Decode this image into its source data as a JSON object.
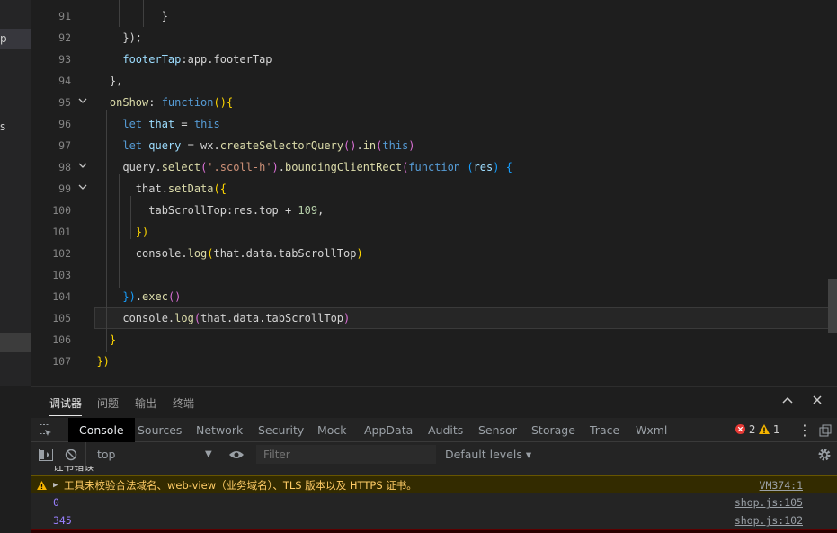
{
  "explorer": {
    "items": [
      {
        "label": "p"
      },
      {
        "label": "s"
      }
    ]
  },
  "editor": {
    "lines": [
      {
        "n": "91",
        "html": "<span class='plain'>            }</span>"
      },
      {
        "n": "92",
        "html": "<span class='plain'>      });</span>"
      },
      {
        "n": "93",
        "html": "<span class='prop'>      footerTap</span><span class='plain'>:app.footerTap</span>"
      },
      {
        "n": "94",
        "html": "<span class='plain'>    },</span>"
      },
      {
        "n": "95",
        "html": "<span class='fn'>    onShow</span><span class='plain'>: </span><span class='kw'>function</span><span class='yel'>(){</span>"
      },
      {
        "n": "96",
        "html": "<span class='kw'>      let </span><span class='var'>that</span><span class='plain'> = </span><span class='kw'>this</span>"
      },
      {
        "n": "97",
        "html": "<span class='kw'>      let </span><span class='var'>query</span><span class='plain'> = wx.</span><span class='fn'>createSelectorQuery</span><span class='pur'>()</span><span class='plain'>.</span><span class='fn'>in</span><span class='pur'>(</span><span class='kw'>this</span><span class='pur'>)</span>"
      },
      {
        "n": "98",
        "html": "<span class='plain'>      query.</span><span class='fn'>select</span><span class='pur'>(</span><span class='str'>'.scoll-h'</span><span class='pur'>)</span><span class='plain'>.</span><span class='fn'>boundingClientRect</span><span class='pur'>(</span><span class='kw'>function</span><span class='plain'> </span><span class='blu'>(</span><span class='prop'>res</span><span class='blu'>)</span><span class='plain'> </span><span class='blu'>{</span>"
      },
      {
        "n": "99",
        "html": "<span class='plain'>        that.</span><span class='fn'>setData</span><span class='yel'>({</span>"
      },
      {
        "n": "100",
        "html": "<span class='plain'>          tabScrollTop:res.top + </span><span class='num'>109</span><span class='plain'>,</span>"
      },
      {
        "n": "101",
        "html": "<span class='yel'>        })</span>"
      },
      {
        "n": "102",
        "html": "<span class='plain'>        console.</span><span class='fn'>log</span><span class='yel'>(</span><span class='plain'>that.data.tabScrollTop</span><span class='yel'>)</span>"
      },
      {
        "n": "103",
        "html": ""
      },
      {
        "n": "104",
        "html": "<span class='blu'>      })</span><span class='plain'>.</span><span class='fn'>exec</span><span class='pur'>()</span>"
      },
      {
        "n": "105",
        "html": "<span class='plain'>      console.</span><span class='fn'>log</span><span class='pur'>(</span><span class='plain'>that.data.tabScrollTop</span><span class='pur'>)</span>"
      },
      {
        "n": "106",
        "html": "<span class='yel'>    }</span>"
      },
      {
        "n": "107",
        "html": "<span class='yel'>  })</span>"
      }
    ],
    "folds": [
      "95",
      "98",
      "99"
    ]
  },
  "panel": {
    "tabs": [
      {
        "label": "调试器",
        "active": true
      },
      {
        "label": "问题",
        "active": false
      },
      {
        "label": "输出",
        "active": false
      },
      {
        "label": "终端",
        "active": false
      }
    ],
    "devtools_tabs": [
      "Console",
      "Sources",
      "Network",
      "Security",
      "Mock",
      "AppData",
      "Audits",
      "Sensor",
      "Storage",
      "Trace",
      "Wxml"
    ],
    "error_count": "2",
    "warning_count": "1",
    "context_select": "top",
    "filter_placeholder": "Filter",
    "levels_label": "Default levels ▾"
  },
  "console": {
    "partial_top": "证书错误",
    "warning": {
      "text": "工具未校验合法域名、web-view（业务域名）、TLS 版本以及 HTTPS 证书。",
      "source": "VM374:1"
    },
    "logs": [
      {
        "value": "0",
        "source": "shop.js:105"
      },
      {
        "value": "345",
        "source": "shop.js:102"
      }
    ]
  },
  "colors": {
    "editor_bg": "#1e1e1e",
    "warning_bg": "#332b00",
    "error_badge": "#e53935",
    "warning_badge": "#f4b400"
  }
}
